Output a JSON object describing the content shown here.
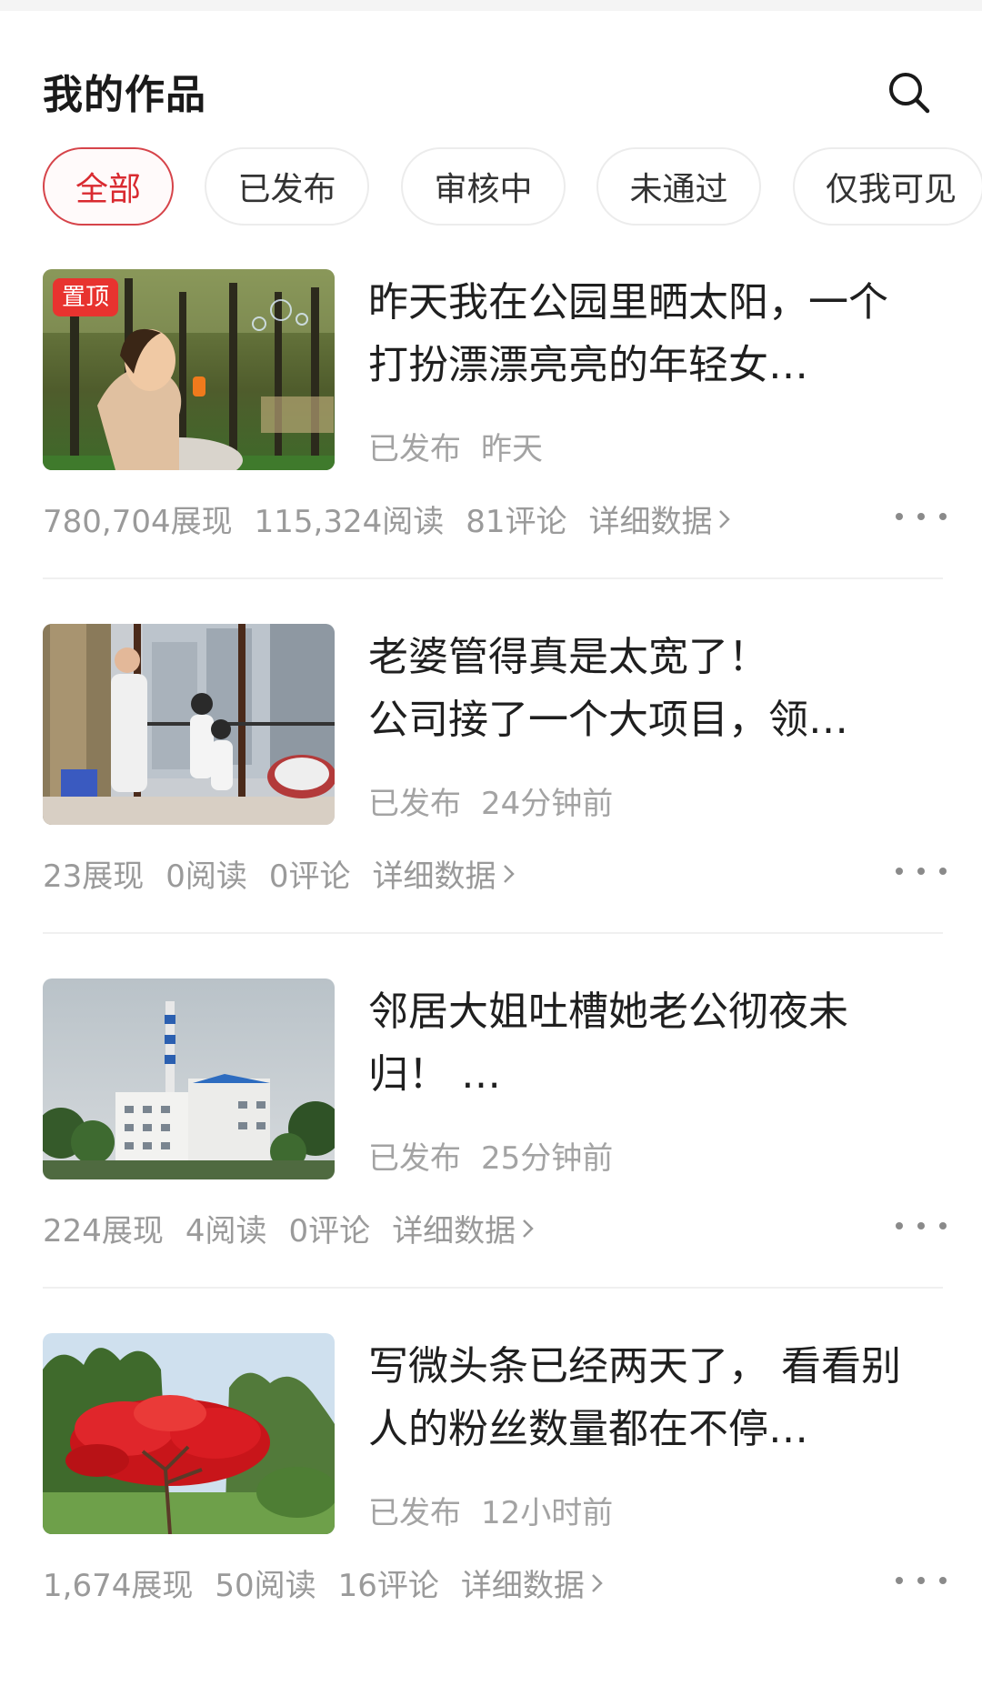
{
  "header": {
    "title": "我的作品",
    "search_icon": "search-icon"
  },
  "tabs": [
    {
      "label": "全部",
      "active": true
    },
    {
      "label": "已发布",
      "active": false
    },
    {
      "label": "审核中",
      "active": false
    },
    {
      "label": "未通过",
      "active": false
    },
    {
      "label": "仅我可见",
      "active": false
    }
  ],
  "accent_color": "#e8332f",
  "articles": [
    {
      "pinned_label": "置顶",
      "title": "昨天我在公园里晒太阳，一个打扮漂漂亮亮的年轻女…",
      "status": "已发布",
      "time": "昨天",
      "impressions": "780,704展现",
      "reads": "115,324阅读",
      "comments": "81评论",
      "detail_label": "详细数据",
      "thumb_desc": "woman-blowing-bubbles-photo"
    },
    {
      "title": "老婆管得真是太宽了！\n公司接了一个大项目，领…",
      "status": "已发布",
      "time": "24分钟前",
      "impressions": "23展现",
      "reads": "0阅读",
      "comments": "0评论",
      "detail_label": "详细数据",
      "thumb_desc": "family-on-balcony-photo"
    },
    {
      "title": "邻居大姐吐槽她老公彻夜未归！ …",
      "status": "已发布",
      "time": "25分钟前",
      "impressions": "224展现",
      "reads": "4阅读",
      "comments": "0评论",
      "detail_label": "详细数据",
      "thumb_desc": "factory-chimney-photo"
    },
    {
      "title": "写微头条已经两天了， 看看别人的粉丝数量都在不停…",
      "status": "已发布",
      "time": "12小时前",
      "impressions": "1,674展现",
      "reads": "50阅读",
      "comments": "16评论",
      "detail_label": "详细数据",
      "thumb_desc": "red-maple-tree-photo"
    }
  ]
}
